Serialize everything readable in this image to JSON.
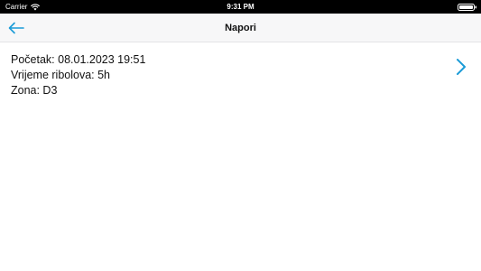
{
  "status_bar": {
    "carrier": "Carrier",
    "time": "9:31 PM"
  },
  "nav_bar": {
    "title": "Napori",
    "back_icon": "arrow-left-icon"
  },
  "list": {
    "items": [
      {
        "start_line": "Početak: 08.01.2023 19:51",
        "duration_line": "Vrijeme ribolova: 5h",
        "zone_line": "Zona: D3",
        "disclosure_icon": "chevron-right-icon"
      }
    ]
  },
  "colors": {
    "accent": "#1a9bd7",
    "nav_background": "#f7f7f8",
    "status_bar_background": "#000000"
  }
}
